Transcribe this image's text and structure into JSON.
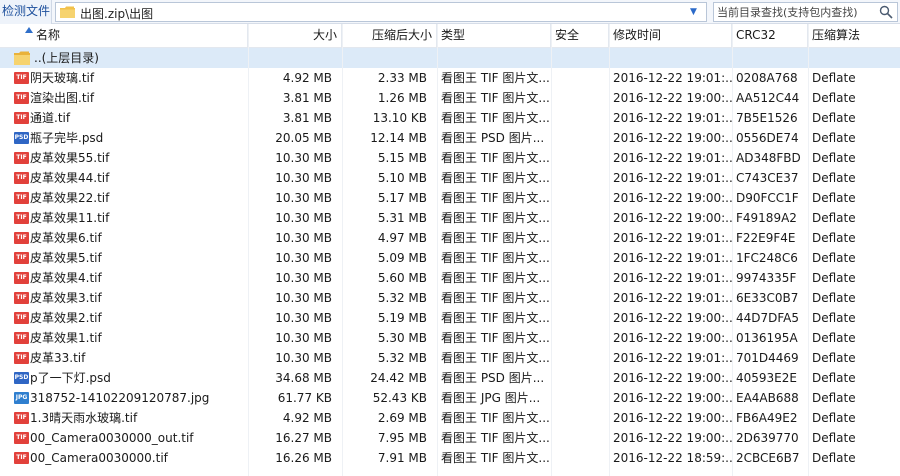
{
  "toolbar": {
    "check_files_label": "检测文件",
    "address": "出图.zip\\出图",
    "search_placeholder": "当前目录查找(支持包内查找)"
  },
  "columns": {
    "name": "名称",
    "size": "大小",
    "packed": "压缩后大小",
    "type": "类型",
    "security": "安全",
    "modified": "修改时间",
    "crc": "CRC32",
    "method": "压缩算法"
  },
  "parent_row": {
    "label": "..(上层目录)"
  },
  "icon_colors": {
    "tif": "#e2413b",
    "psd": "#2f66c4",
    "jpg": "#2f7fcf",
    "folder": "#f2c14a"
  },
  "files": [
    {
      "icon": "TIF",
      "name": "阴天玻璃.tif",
      "size": "4.92 MB",
      "packed": "2.33 MB",
      "type": "看图王 TIF 图片文...",
      "security": "",
      "modified": "2016-12-22 19:01:...",
      "crc": "0208A768",
      "method": "Deflate"
    },
    {
      "icon": "TIF",
      "name": "渲染出图.tif",
      "size": "3.81 MB",
      "packed": "1.26 MB",
      "type": "看图王 TIF 图片文...",
      "security": "",
      "modified": "2016-12-22 19:00:...",
      "crc": "AA512C44",
      "method": "Deflate"
    },
    {
      "icon": "TIF",
      "name": "通道.tif",
      "size": "3.81 MB",
      "packed": "13.10 KB",
      "type": "看图王 TIF 图片文...",
      "security": "",
      "modified": "2016-12-22 19:01:...",
      "crc": "7B5E1526",
      "method": "Deflate"
    },
    {
      "icon": "PSD",
      "name": "瓶子完毕.psd",
      "size": "20.05 MB",
      "packed": "12.14 MB",
      "type": "看图王 PSD 图片...",
      "security": "",
      "modified": "2016-12-22 19:00:...",
      "crc": "0556DE74",
      "method": "Deflate"
    },
    {
      "icon": "TIF",
      "name": "皮革效果55.tif",
      "size": "10.30 MB",
      "packed": "5.15 MB",
      "type": "看图王 TIF 图片文...",
      "security": "",
      "modified": "2016-12-22 19:01:...",
      "crc": "AD348FBD",
      "method": "Deflate"
    },
    {
      "icon": "TIF",
      "name": "皮革效果44.tif",
      "size": "10.30 MB",
      "packed": "5.10 MB",
      "type": "看图王 TIF 图片文...",
      "security": "",
      "modified": "2016-12-22 19:01:...",
      "crc": "C743CE37",
      "method": "Deflate"
    },
    {
      "icon": "TIF",
      "name": "皮革效果22.tif",
      "size": "10.30 MB",
      "packed": "5.17 MB",
      "type": "看图王 TIF 图片文...",
      "security": "",
      "modified": "2016-12-22 19:00:...",
      "crc": "D90FCC1F",
      "method": "Deflate"
    },
    {
      "icon": "TIF",
      "name": "皮革效果11.tif",
      "size": "10.30 MB",
      "packed": "5.31 MB",
      "type": "看图王 TIF 图片文...",
      "security": "",
      "modified": "2016-12-22 19:00:...",
      "crc": "F49189A2",
      "method": "Deflate"
    },
    {
      "icon": "TIF",
      "name": "皮革效果6.tif",
      "size": "10.30 MB",
      "packed": "4.97 MB",
      "type": "看图王 TIF 图片文...",
      "security": "",
      "modified": "2016-12-22 19:01:...",
      "crc": "F22E9F4E",
      "method": "Deflate"
    },
    {
      "icon": "TIF",
      "name": "皮革效果5.tif",
      "size": "10.30 MB",
      "packed": "5.09 MB",
      "type": "看图王 TIF 图片文...",
      "security": "",
      "modified": "2016-12-22 19:01:...",
      "crc": "1FC248C6",
      "method": "Deflate"
    },
    {
      "icon": "TIF",
      "name": "皮革效果4.tif",
      "size": "10.30 MB",
      "packed": "5.60 MB",
      "type": "看图王 TIF 图片文...",
      "security": "",
      "modified": "2016-12-22 19:01:...",
      "crc": "9974335F",
      "method": "Deflate"
    },
    {
      "icon": "TIF",
      "name": "皮革效果3.tif",
      "size": "10.30 MB",
      "packed": "5.32 MB",
      "type": "看图王 TIF 图片文...",
      "security": "",
      "modified": "2016-12-22 19:01:...",
      "crc": "6E33C0B7",
      "method": "Deflate"
    },
    {
      "icon": "TIF",
      "name": "皮革效果2.tif",
      "size": "10.30 MB",
      "packed": "5.19 MB",
      "type": "看图王 TIF 图片文...",
      "security": "",
      "modified": "2016-12-22 19:00:...",
      "crc": "44D7DFA5",
      "method": "Deflate"
    },
    {
      "icon": "TIF",
      "name": "皮革效果1.tif",
      "size": "10.30 MB",
      "packed": "5.30 MB",
      "type": "看图王 TIF 图片文...",
      "security": "",
      "modified": "2016-12-22 19:00:...",
      "crc": "0136195A",
      "method": "Deflate"
    },
    {
      "icon": "TIF",
      "name": "皮革33.tif",
      "size": "10.30 MB",
      "packed": "5.32 MB",
      "type": "看图王 TIF 图片文...",
      "security": "",
      "modified": "2016-12-22 19:01:...",
      "crc": "701D4469",
      "method": "Deflate"
    },
    {
      "icon": "PSD",
      "name": "p了一下灯.psd",
      "size": "34.68 MB",
      "packed": "24.42 MB",
      "type": "看图王 PSD 图片...",
      "security": "",
      "modified": "2016-12-22 19:00:...",
      "crc": "40593E2E",
      "method": "Deflate"
    },
    {
      "icon": "JPG",
      "name": "318752-14102209120787.jpg",
      "size": "61.77 KB",
      "packed": "52.43 KB",
      "type": "看图王 JPG 图片...",
      "security": "",
      "modified": "2016-12-22 19:00:...",
      "crc": "EA4AB688",
      "method": "Deflate"
    },
    {
      "icon": "TIF",
      "name": "1.3晴天雨水玻璃.tif",
      "size": "4.92 MB",
      "packed": "2.69 MB",
      "type": "看图王 TIF 图片文...",
      "security": "",
      "modified": "2016-12-22 19:00:...",
      "crc": "FB6A49E2",
      "method": "Deflate"
    },
    {
      "icon": "TIF",
      "name": "00_Camera0030000_out.tif",
      "size": "16.27 MB",
      "packed": "7.95 MB",
      "type": "看图王 TIF 图片文...",
      "security": "",
      "modified": "2016-12-22 19:00:...",
      "crc": "2D639770",
      "method": "Deflate"
    },
    {
      "icon": "TIF",
      "name": "00_Camera0030000.tif",
      "size": "16.26 MB",
      "packed": "7.91 MB",
      "type": "看图王 TIF 图片文...",
      "security": "",
      "modified": "2016-12-22 18:59:...",
      "crc": "2CBCE6B7",
      "method": "Deflate"
    }
  ]
}
